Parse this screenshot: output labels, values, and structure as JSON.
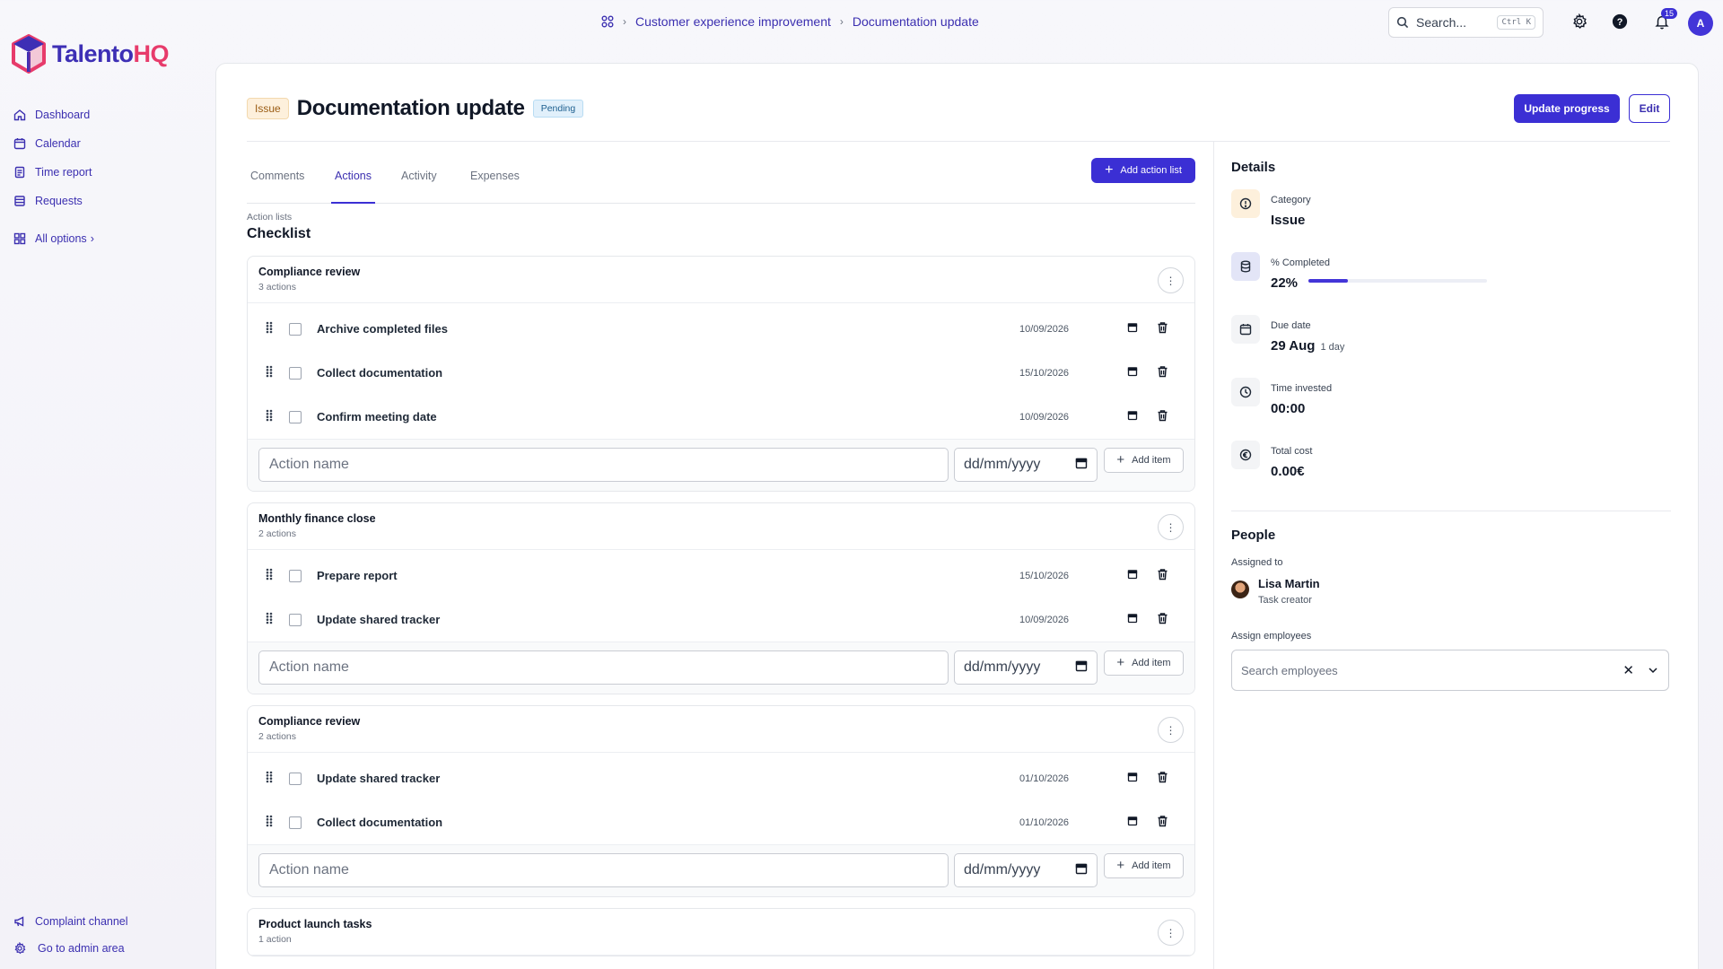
{
  "breadcrumb": {
    "items": [
      "Customer experience improvement",
      "Documentation update"
    ]
  },
  "search": {
    "placeholder": "Search...",
    "shortcut": "Ctrl K"
  },
  "notifications": {
    "count": "15"
  },
  "user": {
    "initial": "A"
  },
  "app": {
    "logo_main": "Talento",
    "logo_accent": "HQ"
  },
  "sidebar": {
    "items": [
      {
        "label": "Dashboard",
        "icon": "home-icon"
      },
      {
        "label": "Calendar",
        "icon": "calendar-icon"
      },
      {
        "label": "Time report",
        "icon": "time-report-icon"
      },
      {
        "label": "Requests",
        "icon": "requests-icon"
      }
    ],
    "all_options": "All options",
    "bottom": [
      {
        "label": "Complaint channel",
        "icon": "megaphone-icon"
      },
      {
        "label": "Go to admin area",
        "icon": "gear-icon"
      }
    ]
  },
  "task": {
    "type_badge": "Issue",
    "title": "Documentation update",
    "status": "Pending",
    "update_button": "Update progress",
    "edit_button": "Edit"
  },
  "tabs": [
    "Comments",
    "Actions",
    "Activity",
    "Expenses"
  ],
  "active_tab": "Actions",
  "add_action_list": "Add action list",
  "action_lists_label": "Action lists",
  "checklist_title": "Checklist",
  "action_input_placeholder": "Action name",
  "date_input_placeholder": "dd/mm/yyyy",
  "add_item_label": "Add item",
  "lists": [
    {
      "name": "Compliance review",
      "count": "3 actions",
      "actions": [
        {
          "name": "Archive completed files",
          "date": "10/09/2026"
        },
        {
          "name": "Collect documentation",
          "date": "15/10/2026"
        },
        {
          "name": "Confirm meeting date",
          "date": "10/09/2026"
        }
      ]
    },
    {
      "name": "Monthly finance close",
      "count": "2 actions",
      "actions": [
        {
          "name": "Prepare report",
          "date": "15/10/2026"
        },
        {
          "name": "Update shared tracker",
          "date": "10/09/2026"
        }
      ]
    },
    {
      "name": "Compliance review",
      "count": "2 actions",
      "actions": [
        {
          "name": "Update shared tracker",
          "date": "01/10/2026"
        },
        {
          "name": "Collect documentation",
          "date": "01/10/2026"
        }
      ]
    },
    {
      "name": "Product launch tasks",
      "count": "1 action",
      "actions": []
    }
  ],
  "details": {
    "title": "Details",
    "category_label": "Category",
    "category_value": "Issue",
    "completed_label": "% Completed",
    "completed_value": "22%",
    "completed_fraction": 0.22,
    "due_label": "Due date",
    "due_value": "29 Aug",
    "due_sub": "1 day",
    "time_label": "Time invested",
    "time_value": "00:00",
    "cost_label": "Total cost",
    "cost_value": "0.00€"
  },
  "people": {
    "title": "People",
    "assigned_label": "Assigned to",
    "assignee_name": "Lisa Martin",
    "assignee_role": "Task creator",
    "assign_label": "Assign employees",
    "assign_placeholder": "Search employees"
  },
  "colors": {
    "accent": "#3b2fd4",
    "logo_pink": "#e73b6b",
    "issue_badge": "#fdf0dc",
    "pending_badge": "#e1f0fb"
  }
}
